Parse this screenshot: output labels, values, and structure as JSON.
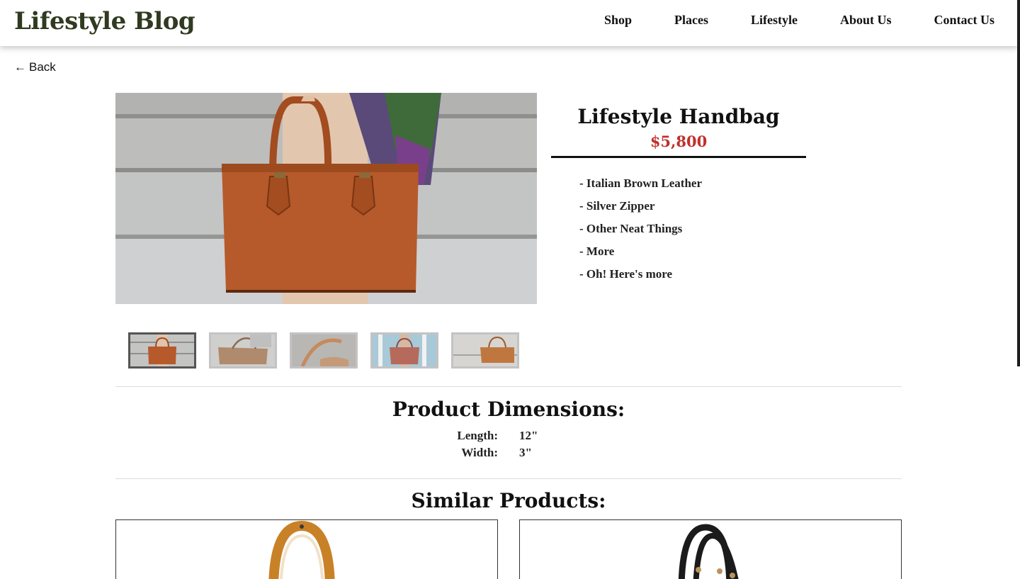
{
  "header": {
    "brand": "Lifestyle Blog",
    "nav": [
      "Shop",
      "Places",
      "Lifestyle",
      "About Us",
      "Contact Us"
    ]
  },
  "back": {
    "arrow": "←",
    "label": "Back"
  },
  "product": {
    "title": "Lifestyle Handbag",
    "price": "$5,800",
    "features": [
      "- Italian Brown Leather",
      "- Silver Zipper",
      "- Other Neat Things",
      "- More",
      "- Oh! Here's more"
    ],
    "thumbnail_count": 5,
    "active_thumbnail": 0
  },
  "dimensions": {
    "title": "Product Dimensions:",
    "rows": [
      {
        "label": "Length:",
        "value": "12\""
      },
      {
        "label": "Width:",
        "value": "3\""
      }
    ]
  },
  "similar": {
    "title": "Similar Products:"
  },
  "colors": {
    "brand": "#2f3a20",
    "price": "#c0302b",
    "leather": "#b65a2b",
    "stairs": "#c9c9c9"
  },
  "icons": [
    "arrow-left-icon"
  ]
}
